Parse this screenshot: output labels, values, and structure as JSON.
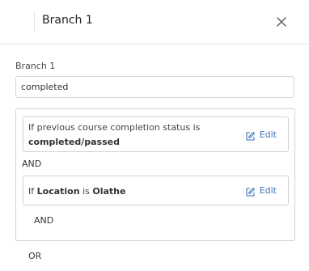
{
  "header": {
    "title": "Branch 1"
  },
  "branch": {
    "label": "Branch 1",
    "value": "completed"
  },
  "conditions": [
    {
      "prefix": "If previous course completion status is",
      "value": "completed/passed",
      "edit_label": "Edit"
    },
    {
      "prefix": "If",
      "field": "Location",
      "middle": "is",
      "value": "Olathe",
      "edit_label": "Edit"
    }
  ],
  "operators": {
    "and_between": "AND",
    "and_after": "AND",
    "or": "OR"
  },
  "icons": {
    "close": "close-icon",
    "edit": "edit-icon"
  },
  "colors": {
    "accent": "#3a73b8",
    "border": "#d3d3d3"
  }
}
